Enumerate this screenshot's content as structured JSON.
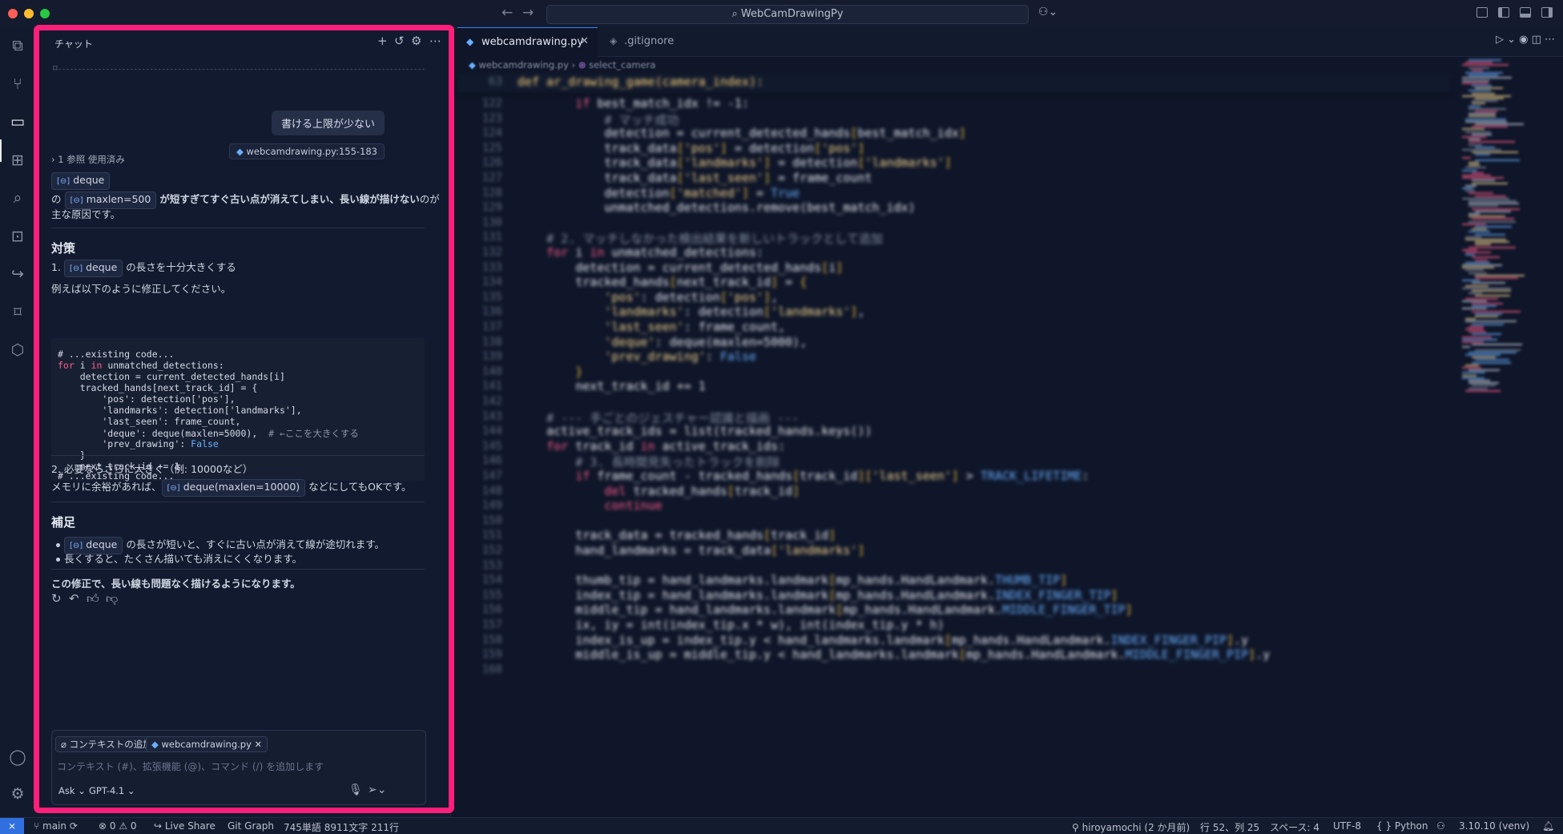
{
  "titlebar": {
    "search_text": "WebCamDrawingPy",
    "copilot_icon": "copilot-icon"
  },
  "chat": {
    "title": "チャット",
    "user_message": "書ける上限が少ない",
    "user_reference": "webcamdrawing.py:155-183",
    "references_toggle": "1 参照 使用済み",
    "reference_chip": "deque",
    "intro_prefix": "の",
    "intro_chip": "maxlen=500",
    "intro_bold": "が短すぎてすぐ古い点が消えてしまい、長い線が描けない",
    "intro_suffix": "のが",
    "intro_line2": "主な原因です。",
    "section1_title": "対策",
    "step1_num": "1.",
    "step1_chip": "deque",
    "step1_text": "の長さを十分大きくする",
    "step1_note": "例えば以下のように修正してください。",
    "code": {
      "l1": "# ...existing code...",
      "l2_kw": "for",
      "l2_a": " i ",
      "l2_in": "in",
      "l2_b": " unmatched_detections:",
      "l3": "    detection = current_detected_hands[i]",
      "l4": "    tracked_hands[next_track_id] = {",
      "l5": "        'pos': detection['pos'],",
      "l6": "        'landmarks': detection['landmarks'],",
      "l7": "        'last_seen': frame_count,",
      "l8_code": "        'deque': deque(maxlen=5000),",
      "l8_comment": "  # ←ここを大きくする",
      "l9_a": "        'prev_drawing': ",
      "l9_b": "False",
      "l10": "    }",
      "l11": "    next_track_id += 1",
      "l12": "# ...existing code..."
    },
    "step2_text": "2. 必要ならさらに大きく（例: 10000など）",
    "step2_prefix": "メモリに余裕があれば、",
    "step2_chip": "deque(maxlen=10000)",
    "step2_suffix": "などにしてもOKです。",
    "section2_title": "補足",
    "bullet1_chip": "deque",
    "bullet1_text": "の長さが短いと、すぐに古い点が消えて線が途切れます。",
    "bullet2_text": "長くすると、たくさん描いても消えにくくなります。",
    "conclusion": "この修正で、長い線も問題なく描けるようになります。",
    "input": {
      "context_add": "コンテキストの追加...",
      "file_chip": "webcamdrawing.py",
      "placeholder": "コンテキスト (#)、拡張機能 (@)、コマンド (/) を追加します",
      "mode": "Ask",
      "model": "GPT-4.1"
    }
  },
  "editor": {
    "tabs": [
      {
        "label": "webcamdrawing.py"
      },
      {
        "label": ".gitignore"
      }
    ],
    "breadcrumb_file": "webcamdrawing.py",
    "breadcrumb_symbol": "select_camera",
    "sticky_line_no": "63",
    "sticky_line": "def ar_drawing_game(camera_index):",
    "lines": [
      {
        "n": "122",
        "t": "        if best_match_idx != -1:"
      },
      {
        "n": "123",
        "t": "            # マッチ成功"
      },
      {
        "n": "124",
        "t": "            detection = current_detected_hands[best_match_idx]"
      },
      {
        "n": "125",
        "t": "            track_data['pos'] = detection['pos']"
      },
      {
        "n": "126",
        "t": "            track_data['landmarks'] = detection['landmarks']"
      },
      {
        "n": "127",
        "t": "            track_data['last_seen'] = frame_count"
      },
      {
        "n": "128",
        "t": "            detection['matched'] = True"
      },
      {
        "n": "129",
        "t": "            unmatched_detections.remove(best_match_idx)"
      },
      {
        "n": "130",
        "t": ""
      },
      {
        "n": "131",
        "t": "    # 2. マッチしなかった検出結果を新しいトラックとして追加"
      },
      {
        "n": "132",
        "t": "    for i in unmatched_detections:"
      },
      {
        "n": "133",
        "t": "        detection = current_detected_hands[i]"
      },
      {
        "n": "134",
        "t": "        tracked_hands[next_track_id] = {"
      },
      {
        "n": "135",
        "t": "            'pos': detection['pos'],"
      },
      {
        "n": "136",
        "t": "            'landmarks': detection['landmarks'],"
      },
      {
        "n": "137",
        "t": "            'last_seen': frame_count,"
      },
      {
        "n": "138",
        "t": "            'deque': deque(maxlen=5000),"
      },
      {
        "n": "139",
        "t": "            'prev_drawing': False"
      },
      {
        "n": "140",
        "t": "        }"
      },
      {
        "n": "141",
        "t": "        next_track_id += 1"
      },
      {
        "n": "142",
        "t": ""
      },
      {
        "n": "143",
        "t": "    # --- 手ごとのジェスチャー認識と描画 ---"
      },
      {
        "n": "144",
        "t": "    active_track_ids = list(tracked_hands.keys())"
      },
      {
        "n": "145",
        "t": "    for track_id in active_track_ids:"
      },
      {
        "n": "146",
        "t": "        # 3. 長時間見失ったトラックを削除"
      },
      {
        "n": "147",
        "t": "        if frame_count - tracked_hands[track_id]['last_seen'] > TRACK_LIFETIME:"
      },
      {
        "n": "148",
        "t": "            del tracked_hands[track_id]"
      },
      {
        "n": "149",
        "t": "            continue"
      },
      {
        "n": "150",
        "t": ""
      },
      {
        "n": "151",
        "t": "        track_data = tracked_hands[track_id]"
      },
      {
        "n": "152",
        "t": "        hand_landmarks = track_data['landmarks']"
      },
      {
        "n": "153",
        "t": ""
      },
      {
        "n": "154",
        "t": "        thumb_tip = hand_landmarks.landmark[mp_hands.HandLandmark.THUMB_TIP]"
      },
      {
        "n": "155",
        "t": "        index_tip = hand_landmarks.landmark[mp_hands.HandLandmark.INDEX_FINGER_TIP]"
      },
      {
        "n": "156",
        "t": "        middle_tip = hand_landmarks.landmark[mp_hands.HandLandmark.MIDDLE_FINGER_TIP]"
      },
      {
        "n": "157",
        "t": "        ix, iy = int(index_tip.x * w), int(index_tip.y * h)"
      },
      {
        "n": "158",
        "t": "        index_is_up = index_tip.y < hand_landmarks.landmark[mp_hands.HandLandmark.INDEX_FINGER_PIP].y"
      },
      {
        "n": "159",
        "t": "        middle_is_up = middle_tip.y < hand_landmarks.landmark[mp_hands.HandLandmark.MIDDLE_FINGER_PIP].y"
      },
      {
        "n": "160",
        "t": ""
      }
    ]
  },
  "statusbar": {
    "branch": "main",
    "problems": "⊗ 0 ⚠ 0",
    "live_share": "Live Share",
    "git_graph": "Git Graph",
    "word_count": "745単語  8911文字  211行",
    "blame": "hiroyamochi (2 か月前)",
    "position": "行 52、列 25",
    "spaces": "スペース: 4",
    "encoding": "UTF-8",
    "language": "Python",
    "python_version": "3.10.10 (venv)"
  },
  "colors": {
    "highlight_border": "#ff1f7a",
    "accent": "#3b82f6",
    "keyword": "#ff5c8a",
    "string": "#f4d58d"
  }
}
